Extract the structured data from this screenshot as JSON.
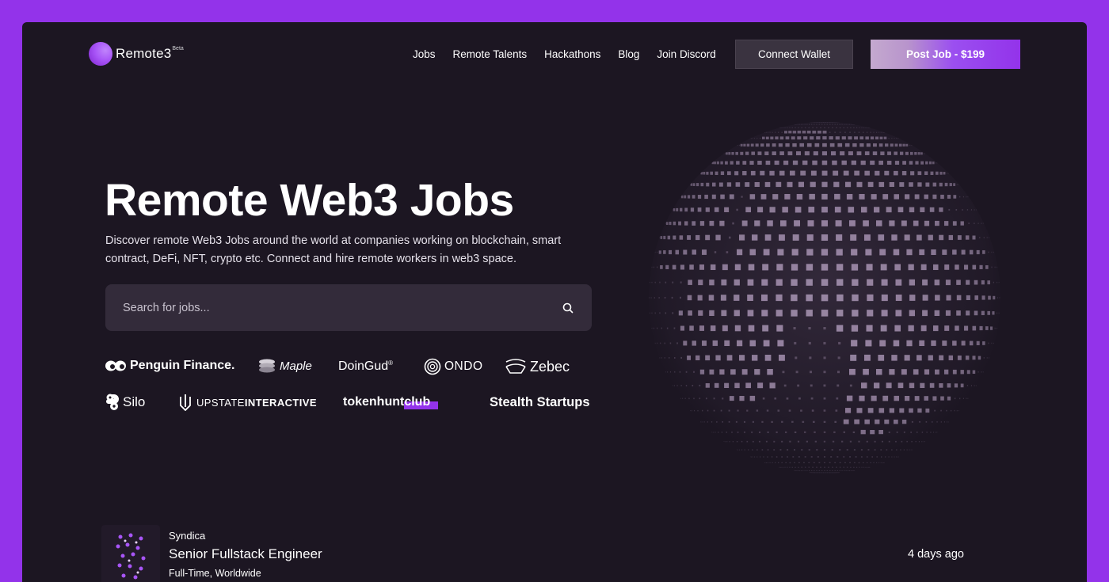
{
  "header": {
    "logo_text": "Remote3",
    "logo_badge": "Beta",
    "nav": [
      "Jobs",
      "Remote Talents",
      "Hackathons",
      "Blog",
      "Join Discord"
    ],
    "connect_wallet": "Connect Wallet",
    "post_job": "Post Job - $199"
  },
  "hero": {
    "title": "Remote Web3 Jobs",
    "subtitle": "Discover remote Web3 Jobs around the world at companies working on blockchain, smart contract, DeFi, NFT, crypto etc. Connect and hire remote workers in web3 space.",
    "search_placeholder": "Search for jobs..."
  },
  "partners": {
    "p1": "Penguin Finance.",
    "p2": "Maple",
    "p3": "DoinGud",
    "p3_mark": "®",
    "p4": "ONDO",
    "p5": "Zebec",
    "p6": "Silo",
    "p7a": "UPSTATE ",
    "p7b": "INTERACTIVE",
    "p8a": "tokenhunt",
    "p8b": "club",
    "p9": "Stealth Startups"
  },
  "job": {
    "company": "Syndica",
    "title": "Senior Fullstack Engineer",
    "meta": "Full-Time, Worldwide",
    "posted": "4 days ago"
  },
  "colors": {
    "outer": "#9333ea",
    "background": "#1c1622",
    "accent": "#9333ea",
    "globe_tile": "#9d8aa8"
  }
}
